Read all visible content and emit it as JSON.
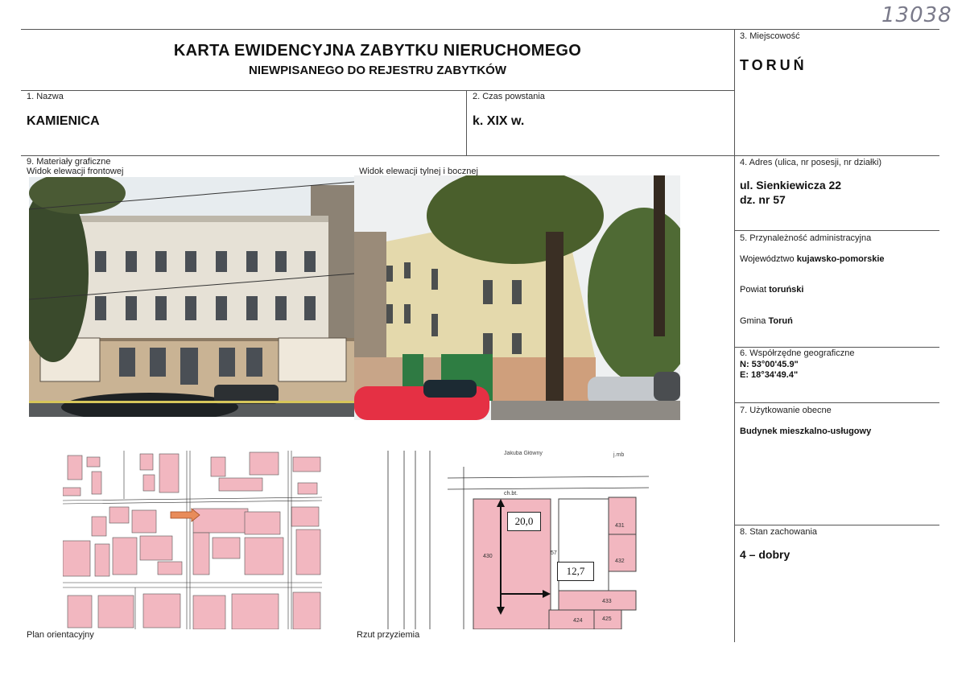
{
  "archive_number": "13038",
  "header": {
    "title": "KARTA EWIDENCYJNA ZABYTKU NIERUCHOMEGO",
    "subtitle": "NIEWPISANEGO DO REJESTRU ZABYTKÓW"
  },
  "fields": {
    "name_label": "1. Nazwa",
    "name_value": "KAMIENICA",
    "period_label": "2. Czas powstania",
    "period_value": "k. XIX w.",
    "locality_label": "3. Miejscowość",
    "locality_value": "TORUŃ",
    "address_label": "4. Adres (ulica, nr posesji, nr działki)",
    "address_line1": "ul. Sienkiewicza 22",
    "address_line2": "dz. nr 57",
    "admin_label": "5. Przynależność administracyjna",
    "voivodeship_prefix": "Województwo ",
    "voivodeship_value": "kujawsko-pomorskie",
    "county_prefix": "Powiat ",
    "county_value": "toruński",
    "commune_prefix": "Gmina ",
    "commune_value": "Toruń",
    "coords_label": "6. Współrzędne geograficzne",
    "coords_n": "N: 53°00'45.9\"",
    "coords_e": "E: 18°34'49.4\"",
    "usage_label": "7. Użytkowanie obecne",
    "usage_value": "Budynek mieszkalno-usługowy",
    "condition_label": "8. Stan zachowania",
    "condition_value": "4 – dobry"
  },
  "graphics": {
    "section_label": "9. Materiały graficzne",
    "front_caption": "Widok elewacji frontowej",
    "rear_caption": "Widok elewacji tylnej i bocznej",
    "plan_caption": "Plan orientacyjny",
    "floor_caption": "Rzut przyziemia",
    "dim_length": "20,0",
    "dim_width": "12,7",
    "floor_street_label": "Jakuba Główny",
    "floor_scale": "j.mb",
    "floor_plot_430": "430",
    "floor_plot_57": "57",
    "floor_plot_431": "431",
    "floor_plot_432": "432",
    "floor_plot_433": "433",
    "floor_plot_424": "424",
    "floor_plot_425": "425",
    "floor_chbt": "ch.bt."
  },
  "colors": {
    "plot_pink": "#f2b7c0",
    "arrow_fill": "#e88c5a",
    "line": "#555555"
  }
}
